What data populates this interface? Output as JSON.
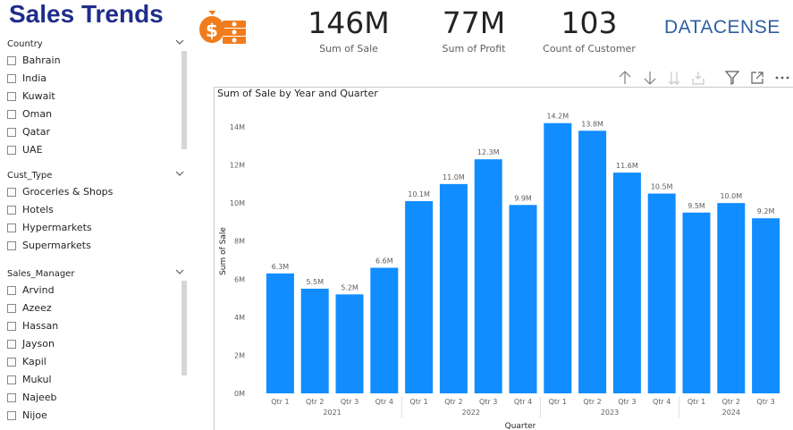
{
  "header": {
    "title": "Sales Trends",
    "logo_text": "DATACENSE",
    "money_icon": "money-bag-icon"
  },
  "kpis": [
    {
      "value": "146M",
      "label": "Sum of Sale"
    },
    {
      "value": "77M",
      "label": "Sum of Profit"
    },
    {
      "value": "103",
      "label": "Count of Customer"
    }
  ],
  "slicers": {
    "country": {
      "title": "Country",
      "items": [
        "Bahrain",
        "India",
        "Kuwait",
        "Oman",
        "Qatar",
        "UAE"
      ]
    },
    "cust_type": {
      "title": "Cust_Type",
      "items": [
        "Groceries & Shops",
        "Hotels",
        "Hypermarkets",
        "Supermarkets"
      ]
    },
    "sales_manager": {
      "title": "Sales_Manager",
      "items": [
        "Arvind",
        "Azeez",
        "Hassan",
        "Jayson",
        "Kapil",
        "Mukul",
        "Najeeb",
        "Nijoe"
      ]
    }
  },
  "toolbar": {
    "icons": [
      "arrow-up-icon",
      "arrow-down-icon",
      "double-arrow-down-icon",
      "expand-hierarchy-icon",
      "filter-icon",
      "focus-mode-icon",
      "more-options-icon"
    ]
  },
  "colors": {
    "bar": "#118dff",
    "title": "#1f2d8a",
    "icon_orange": "#f07c1e"
  },
  "chart_data": {
    "type": "bar",
    "title": "Sum of Sale by Year and Quarter",
    "xlabel": "Quarter",
    "ylabel": "Sum of Sale",
    "ylim": [
      0,
      14
    ],
    "y_unit": "M",
    "y_ticks": [
      "0M",
      "2M",
      "4M",
      "6M",
      "8M",
      "10M",
      "12M",
      "14M"
    ],
    "y_tick_values": [
      0,
      2,
      4,
      6,
      8,
      10,
      12,
      14
    ],
    "categories": [
      "Qtr 1",
      "Qtr 2",
      "Qtr 3",
      "Qtr 4",
      "Qtr 1",
      "Qtr 2",
      "Qtr 3",
      "Qtr 4",
      "Qtr 1",
      "Qtr 2",
      "Qtr 3",
      "Qtr 4",
      "Qtr 1",
      "Qtr 2",
      "Qtr 3"
    ],
    "years": [
      {
        "label": "2021",
        "count": 4
      },
      {
        "label": "2022",
        "count": 4
      },
      {
        "label": "2023",
        "count": 4
      },
      {
        "label": "2024",
        "count": 3
      }
    ],
    "values": [
      6.3,
      5.5,
      5.2,
      6.6,
      10.1,
      11.0,
      12.3,
      9.9,
      14.2,
      13.8,
      11.6,
      10.5,
      9.5,
      10.0,
      9.2
    ],
    "data_labels": [
      "6.3M",
      "5.5M",
      "5.2M",
      "6.6M",
      "10.1M",
      "11.0M",
      "12.3M",
      "9.9M",
      "14.2M",
      "13.8M",
      "11.6M",
      "10.5M",
      "9.5M",
      "10.0M",
      "9.2M"
    ]
  }
}
